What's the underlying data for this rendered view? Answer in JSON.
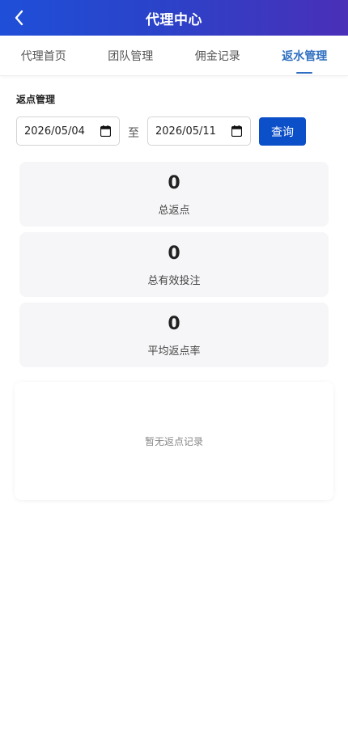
{
  "header": {
    "title": "代理中心",
    "back_icon": "chevron-left-icon"
  },
  "tabs": [
    {
      "label": "代理首页",
      "active": false
    },
    {
      "label": "团队管理",
      "active": false
    },
    {
      "label": "佣金记录",
      "active": false
    },
    {
      "label": "返水管理",
      "active": true
    }
  ],
  "filter": {
    "section_title": "返点管理",
    "start_date": "2026/05/04",
    "separator": "至",
    "end_date": "2026/05/11",
    "query_label": "查询",
    "calendar_icon": "calendar-icon"
  },
  "stats": [
    {
      "value": "0",
      "label": "总返点"
    },
    {
      "value": "0",
      "label": "总有效投注"
    },
    {
      "value": "0",
      "label": "平均返点率"
    }
  ],
  "empty": {
    "text": "暂无返点记录"
  },
  "colors": {
    "accent": "#2f6fc1",
    "button": "#0b4fc9",
    "header_start": "#1f4fd8",
    "header_end": "#4a2fb8"
  }
}
